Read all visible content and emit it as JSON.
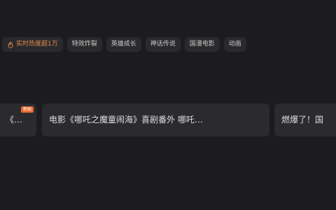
{
  "tags": {
    "hot": "实时热度超1万",
    "items": [
      "特效炸裂",
      "英雄成长",
      "神话传说",
      "国漫电影",
      "动画"
    ]
  },
  "cards": {
    "c1_text": "《…",
    "c1_badge": "新剧",
    "c2_text": "电影《哪吒之魔童闹海》喜剧番外 哪吒…",
    "c3_text": "燃爆了！国"
  },
  "colors": {
    "background": "#1c1c1e",
    "tag_bg": "#2a2a2d",
    "card_bg": "#2b2b2f",
    "hot_accent": "#e58b4b",
    "badge": "#e66a2c"
  }
}
